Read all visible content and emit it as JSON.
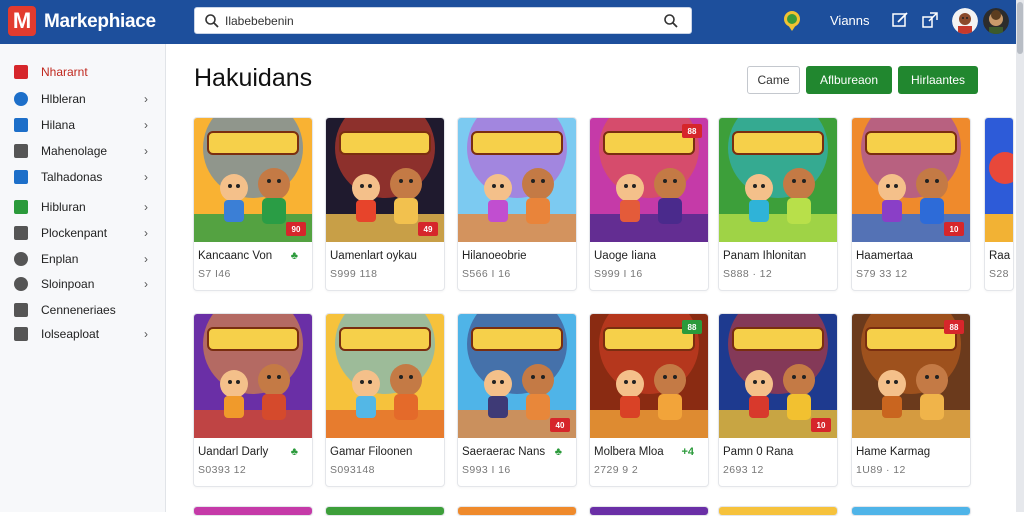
{
  "app": {
    "logo_letter": "M",
    "brand": "Markephiace",
    "search": {
      "value": "Ilabebebenin",
      "placeholder": ""
    },
    "menu_label": "Vianns"
  },
  "sidebar": {
    "items": [
      {
        "label": "Nhararnt",
        "icon": "home-icon",
        "color": "#d6262b",
        "chevron": false,
        "active": true
      },
      {
        "label": "Hlbleran",
        "icon": "globe-icon",
        "color": "#1d6fc9",
        "chevron": true
      },
      {
        "label": "Hilana",
        "icon": "grid-icon",
        "color": "#1d6fc9",
        "chevron": true
      },
      {
        "label": "Mahenolage",
        "icon": "chart-icon",
        "color": "#555555",
        "chevron": true
      },
      {
        "label": "Talhadonas",
        "icon": "book-icon",
        "color": "#1d6fc9",
        "chevron": true
      },
      {
        "label": "Hibluran",
        "icon": "check-icon",
        "color": "#2b9a3b",
        "chevron": true
      },
      {
        "label": "Plockenpant",
        "icon": "doc-icon",
        "color": "#555555",
        "chevron": true
      },
      {
        "label": "Enplan",
        "icon": "eye-icon",
        "color": "#555555",
        "chevron": true
      },
      {
        "label": "Sloinpoan",
        "icon": "cloud-icon",
        "color": "#555555",
        "chevron": true
      },
      {
        "label": "Cenneneriaes",
        "icon": "link-icon",
        "color": "#555555",
        "chevron": false
      },
      {
        "label": "Iolseaploat",
        "icon": "nodes-icon",
        "color": "#555555",
        "chevron": true
      }
    ]
  },
  "main": {
    "title": "Hakuidans",
    "buttons": {
      "outline": "Came",
      "primary1": "Aflbureaon",
      "primary2": "Hirlaantes"
    }
  },
  "colors": {
    "topbar": "#1d4f9c",
    "accent_red": "#d6262b",
    "accent_green": "#21872f"
  },
  "cards_row1": [
    {
      "title": "Kancaanc Von",
      "price": "S7 I46",
      "badge": "90",
      "badge_color": "red",
      "badge_pos": "bottom",
      "mark": "♣"
    },
    {
      "title": "Uamenlart oykau",
      "price": "S999 118",
      "badge": "49",
      "badge_color": "red",
      "badge_pos": "bottom",
      "mark": ""
    },
    {
      "title": "Hilanoeobrie",
      "price": "S566 I 16",
      "badge": "",
      "badge_color": "",
      "badge_pos": "",
      "mark": ""
    },
    {
      "title": "Uaoge Iiana",
      "price": "S999 I 16",
      "badge": "88",
      "badge_color": "red",
      "badge_pos": "top",
      "mark": ""
    },
    {
      "title": "Panam Ihlonitan",
      "price": "S888 · 12",
      "badge": "",
      "badge_color": "",
      "badge_pos": "",
      "mark": ""
    },
    {
      "title": "Haamertaa",
      "price": "S79 33 12",
      "badge": "10",
      "badge_color": "red",
      "badge_pos": "bottom",
      "mark": ""
    }
  ],
  "cards_row2": [
    {
      "title": "Uandarl Darly",
      "price": "S0393 12",
      "badge": "",
      "badge_color": "",
      "badge_pos": "",
      "mark": "♣"
    },
    {
      "title": "Gamar Filoonen",
      "price": "S093148",
      "badge": "",
      "badge_color": "",
      "badge_pos": "",
      "mark": ""
    },
    {
      "title": "Saeraerac Nans",
      "price": "S993 I 16",
      "badge": "40",
      "badge_color": "red",
      "badge_pos": "bottom",
      "mark": "♣"
    },
    {
      "title": "Molbera Mloa",
      "price": "2729 9 2",
      "badge": "88",
      "badge_color": "green",
      "badge_pos": "top",
      "mark": "+4"
    },
    {
      "title": "Pamn 0 Rana",
      "price": "2693 12",
      "badge": "10",
      "badge_color": "red",
      "badge_pos": "bottom",
      "mark": ""
    },
    {
      "title": "Hame Karmag",
      "price": "1U89 · 12",
      "badge": "88",
      "badge_color": "red",
      "badge_pos": "top",
      "mark": ""
    }
  ],
  "card_row1_partial": {
    "title": "Raa",
    "price": "S28"
  }
}
